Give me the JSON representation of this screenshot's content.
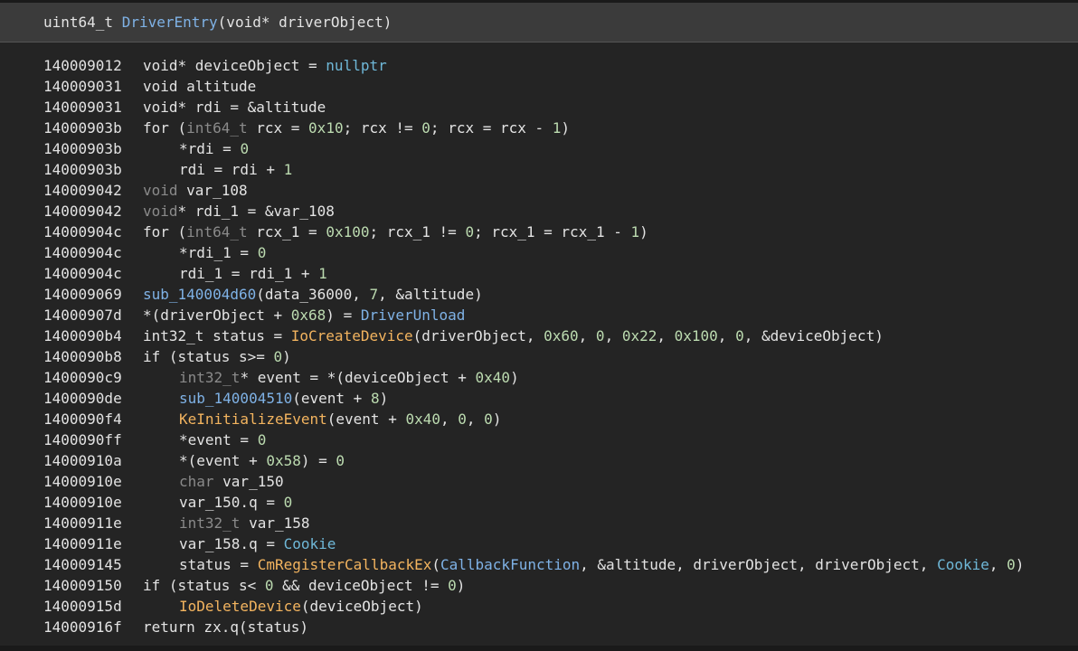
{
  "header": {
    "signature": [
      {
        "t": "uint64_t ",
        "c": "plain"
      },
      {
        "t": "DriverEntry",
        "c": "func"
      },
      {
        "t": "(void* driverObject)",
        "c": "plain"
      }
    ]
  },
  "lines": [
    {
      "addr": "140009012",
      "indent": 0,
      "tokens": [
        {
          "t": "void* deviceObject = ",
          "c": "plain"
        },
        {
          "t": "nullptr",
          "c": "ptr"
        }
      ]
    },
    {
      "addr": "140009031",
      "indent": 0,
      "tokens": [
        {
          "t": "void altitude",
          "c": "plain"
        }
      ]
    },
    {
      "addr": "140009031",
      "indent": 0,
      "tokens": [
        {
          "t": "void* rdi = &altitude",
          "c": "plain"
        }
      ]
    },
    {
      "addr": "14000903b",
      "indent": 0,
      "tokens": [
        {
          "t": "for (",
          "c": "plain"
        },
        {
          "t": "int64_t",
          "c": "type"
        },
        {
          "t": " rcx = ",
          "c": "plain"
        },
        {
          "t": "0x10",
          "c": "num"
        },
        {
          "t": "; rcx != ",
          "c": "plain"
        },
        {
          "t": "0",
          "c": "num"
        },
        {
          "t": "; rcx = rcx - ",
          "c": "plain"
        },
        {
          "t": "1",
          "c": "num"
        },
        {
          "t": ")",
          "c": "plain"
        }
      ]
    },
    {
      "addr": "14000903b",
      "indent": 1,
      "tokens": [
        {
          "t": "*rdi = ",
          "c": "plain"
        },
        {
          "t": "0",
          "c": "num"
        }
      ]
    },
    {
      "addr": "14000903b",
      "indent": 1,
      "tokens": [
        {
          "t": "rdi = rdi + ",
          "c": "plain"
        },
        {
          "t": "1",
          "c": "num"
        }
      ]
    },
    {
      "addr": "140009042",
      "indent": 0,
      "tokens": [
        {
          "t": "void",
          "c": "type"
        },
        {
          "t": " var_108",
          "c": "plain"
        }
      ]
    },
    {
      "addr": "140009042",
      "indent": 0,
      "tokens": [
        {
          "t": "void",
          "c": "type"
        },
        {
          "t": "* rdi_1 = &var_108",
          "c": "plain"
        }
      ]
    },
    {
      "addr": "14000904c",
      "indent": 0,
      "tokens": [
        {
          "t": "for (",
          "c": "plain"
        },
        {
          "t": "int64_t",
          "c": "type"
        },
        {
          "t": " rcx_1 = ",
          "c": "plain"
        },
        {
          "t": "0x100",
          "c": "num"
        },
        {
          "t": "; rcx_1 != ",
          "c": "plain"
        },
        {
          "t": "0",
          "c": "num"
        },
        {
          "t": "; rcx_1 = rcx_1 - ",
          "c": "plain"
        },
        {
          "t": "1",
          "c": "num"
        },
        {
          "t": ")",
          "c": "plain"
        }
      ]
    },
    {
      "addr": "14000904c",
      "indent": 1,
      "tokens": [
        {
          "t": "*rdi_1 = ",
          "c": "plain"
        },
        {
          "t": "0",
          "c": "num"
        }
      ]
    },
    {
      "addr": "14000904c",
      "indent": 1,
      "tokens": [
        {
          "t": "rdi_1 = rdi_1 + ",
          "c": "plain"
        },
        {
          "t": "1",
          "c": "num"
        }
      ]
    },
    {
      "addr": "140009069",
      "indent": 0,
      "tokens": [
        {
          "t": "sub_140004d60",
          "c": "func"
        },
        {
          "t": "(data_36000, ",
          "c": "plain"
        },
        {
          "t": "7",
          "c": "num"
        },
        {
          "t": ", &altitude)",
          "c": "plain"
        }
      ]
    },
    {
      "addr": "14000907d",
      "indent": 0,
      "tokens": [
        {
          "t": "*(driverObject + ",
          "c": "plain"
        },
        {
          "t": "0x68",
          "c": "num"
        },
        {
          "t": ") = ",
          "c": "plain"
        },
        {
          "t": "DriverUnload",
          "c": "func"
        }
      ]
    },
    {
      "addr": "1400090b4",
      "indent": 0,
      "tokens": [
        {
          "t": "int32_t status = ",
          "c": "plain"
        },
        {
          "t": "IoCreateDevice",
          "c": "import"
        },
        {
          "t": "(driverObject, ",
          "c": "plain"
        },
        {
          "t": "0x60",
          "c": "num"
        },
        {
          "t": ", ",
          "c": "plain"
        },
        {
          "t": "0",
          "c": "num"
        },
        {
          "t": ", ",
          "c": "plain"
        },
        {
          "t": "0x22",
          "c": "num"
        },
        {
          "t": ", ",
          "c": "plain"
        },
        {
          "t": "0x100",
          "c": "num"
        },
        {
          "t": ", ",
          "c": "plain"
        },
        {
          "t": "0",
          "c": "num"
        },
        {
          "t": ", &deviceObject)",
          "c": "plain"
        }
      ]
    },
    {
      "addr": "1400090b8",
      "indent": 0,
      "tokens": [
        {
          "t": "if (status s>= ",
          "c": "plain"
        },
        {
          "t": "0",
          "c": "num"
        },
        {
          "t": ")",
          "c": "plain"
        }
      ]
    },
    {
      "addr": "1400090c9",
      "indent": 1,
      "tokens": [
        {
          "t": "int32_t",
          "c": "type"
        },
        {
          "t": "* event = *(deviceObject + ",
          "c": "plain"
        },
        {
          "t": "0x40",
          "c": "num"
        },
        {
          "t": ")",
          "c": "plain"
        }
      ]
    },
    {
      "addr": "1400090de",
      "indent": 1,
      "tokens": [
        {
          "t": "sub_140004510",
          "c": "func"
        },
        {
          "t": "(event + ",
          "c": "plain"
        },
        {
          "t": "8",
          "c": "num"
        },
        {
          "t": ")",
          "c": "plain"
        }
      ]
    },
    {
      "addr": "1400090f4",
      "indent": 1,
      "tokens": [
        {
          "t": "KeInitializeEvent",
          "c": "import"
        },
        {
          "t": "(event + ",
          "c": "plain"
        },
        {
          "t": "0x40",
          "c": "num"
        },
        {
          "t": ", ",
          "c": "plain"
        },
        {
          "t": "0",
          "c": "num"
        },
        {
          "t": ", ",
          "c": "plain"
        },
        {
          "t": "0",
          "c": "num"
        },
        {
          "t": ")",
          "c": "plain"
        }
      ]
    },
    {
      "addr": "1400090ff",
      "indent": 1,
      "tokens": [
        {
          "t": "*event = ",
          "c": "plain"
        },
        {
          "t": "0",
          "c": "num"
        }
      ]
    },
    {
      "addr": "14000910a",
      "indent": 1,
      "tokens": [
        {
          "t": "*(event + ",
          "c": "plain"
        },
        {
          "t": "0x58",
          "c": "num"
        },
        {
          "t": ") = ",
          "c": "plain"
        },
        {
          "t": "0",
          "c": "num"
        }
      ]
    },
    {
      "addr": "14000910e",
      "indent": 1,
      "tokens": [
        {
          "t": "char",
          "c": "type"
        },
        {
          "t": " var_150",
          "c": "plain"
        }
      ]
    },
    {
      "addr": "14000910e",
      "indent": 1,
      "tokens": [
        {
          "t": "var_150.q = ",
          "c": "plain"
        },
        {
          "t": "0",
          "c": "num"
        }
      ]
    },
    {
      "addr": "14000911e",
      "indent": 1,
      "tokens": [
        {
          "t": "int32_t",
          "c": "type"
        },
        {
          "t": " var_158",
          "c": "plain"
        }
      ]
    },
    {
      "addr": "14000911e",
      "indent": 1,
      "tokens": [
        {
          "t": "var_158.q = ",
          "c": "plain"
        },
        {
          "t": "Cookie",
          "c": "ptr"
        }
      ]
    },
    {
      "addr": "140009145",
      "indent": 1,
      "tokens": [
        {
          "t": "status = ",
          "c": "plain"
        },
        {
          "t": "CmRegisterCallbackEx",
          "c": "import"
        },
        {
          "t": "(",
          "c": "plain"
        },
        {
          "t": "CallbackFunction",
          "c": "func"
        },
        {
          "t": ", &altitude, driverObject, driverObject, ",
          "c": "plain"
        },
        {
          "t": "Cookie",
          "c": "ptr"
        },
        {
          "t": ", ",
          "c": "plain"
        },
        {
          "t": "0",
          "c": "num"
        },
        {
          "t": ")",
          "c": "plain"
        }
      ]
    },
    {
      "addr": "140009150",
      "indent": 0,
      "tokens": [
        {
          "t": "if (status s< ",
          "c": "plain"
        },
        {
          "t": "0",
          "c": "num"
        },
        {
          "t": " && deviceObject != ",
          "c": "plain"
        },
        {
          "t": "0",
          "c": "num"
        },
        {
          "t": ")",
          "c": "plain"
        }
      ]
    },
    {
      "addr": "14000915d",
      "indent": 1,
      "tokens": [
        {
          "t": "IoDeleteDevice",
          "c": "import"
        },
        {
          "t": "(deviceObject)",
          "c": "plain"
        }
      ]
    },
    {
      "addr": "14000916f",
      "indent": 0,
      "tokens": [
        {
          "t": "return zx.q(status)",
          "c": "plain"
        }
      ]
    }
  ],
  "colors": {
    "plain": "#e3e3e3",
    "type": "#8a8a8a",
    "func": "#7fb2e6",
    "import": "#f3b45f",
    "num": "#bcdbb0",
    "ptr": "#6fb8d8"
  }
}
